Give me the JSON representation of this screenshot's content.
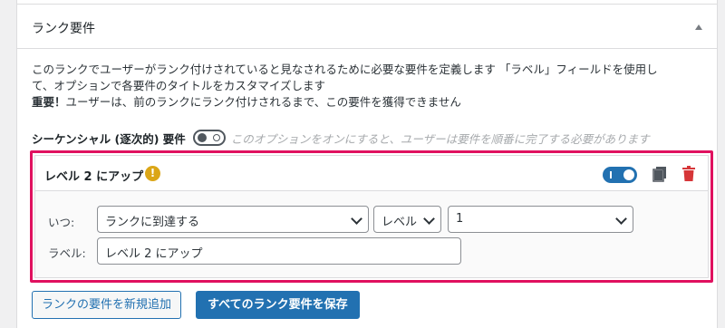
{
  "panel": {
    "title": "ランク要件"
  },
  "description": {
    "line1": "このランクでユーザーがランク付けされていると見なされるために必要な要件を定義します 「ラベル」フィールドを使用し",
    "line2": "て、オプションで各要件のタイトルをカスタマイズします",
    "important_label": "重要！",
    "important_text": "ユーザーは、前のランクにランク付けされるまで、この要件を獲得できません"
  },
  "sequential": {
    "label": "シーケンシャル (逐次的) 要件",
    "hint": "このオプションをオンにすると、ユーザーは要件を順番に完了する必要があります",
    "enabled": false
  },
  "requirement": {
    "title": "レベル 2 にアップ",
    "warning_glyph": "!",
    "enabled": true,
    "when_label": "いつ:",
    "trigger_value": "ランクに到達する",
    "type_value": "レベル",
    "level_value": "1",
    "label_label": "ラベル:",
    "label_value": "レベル 2 にアップ"
  },
  "buttons": {
    "add_new": "ランクの要件を新規追加",
    "save_all": "すべてのランク要件を保存"
  },
  "colors": {
    "accent": "#2271b1",
    "highlight_border": "#e0115f",
    "warning": "#dba617",
    "danger": "#d63638"
  }
}
